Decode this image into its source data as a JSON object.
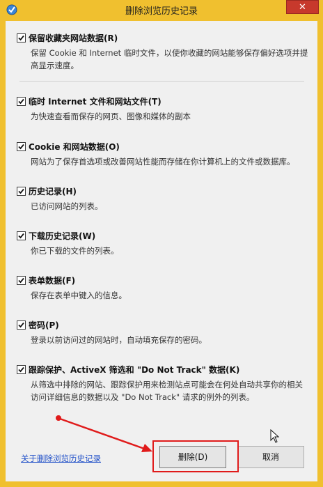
{
  "window": {
    "title": "删除浏览历史记录",
    "close_glyph": "✕"
  },
  "options": [
    {
      "label": "保留收藏夹网站数据(R)",
      "checked": true,
      "desc": "保留 Cookie 和 Internet 临时文件，以使你收藏的网站能够保存偏好选项并提高显示速度。"
    },
    {
      "label": "临时 Internet 文件和网站文件(T)",
      "checked": true,
      "desc": "为快速查看而保存的网页、图像和媒体的副本"
    },
    {
      "label": "Cookie 和网站数据(O)",
      "checked": true,
      "desc": "网站为了保存首选项或改善网站性能而存储在你计算机上的文件或数据库。"
    },
    {
      "label": "历史记录(H)",
      "checked": true,
      "desc": "已访问网站的列表。"
    },
    {
      "label": "下载历史记录(W)",
      "checked": true,
      "desc": "你已下载的文件的列表。"
    },
    {
      "label": "表单数据(F)",
      "checked": true,
      "desc": "保存在表单中键入的信息。"
    },
    {
      "label": "密码(P)",
      "checked": true,
      "desc": "登录以前访问过的网站时，自动填充保存的密码。"
    },
    {
      "label": "跟踪保护、ActiveX 筛选和 \"Do Not Track\" 数据(K)",
      "checked": true,
      "desc": "从筛选中排除的网站、跟踪保护用来检测站点可能会在何处自动共享你的相关访问详细信息的数据以及 \"Do Not Track\" 请求的例外的列表。"
    }
  ],
  "footer": {
    "help_link": "关于删除浏览历史记录",
    "delete_label": "删除(D)",
    "cancel_label": "取消"
  },
  "colors": {
    "frame": "#f0c02f",
    "close": "#c7392c",
    "annotation": "#e01b1b",
    "link": "#1f4fc8"
  },
  "icons": {
    "app": "ie-history-icon",
    "check": "checkmark-icon",
    "cursor": "mouse-pointer-icon"
  }
}
